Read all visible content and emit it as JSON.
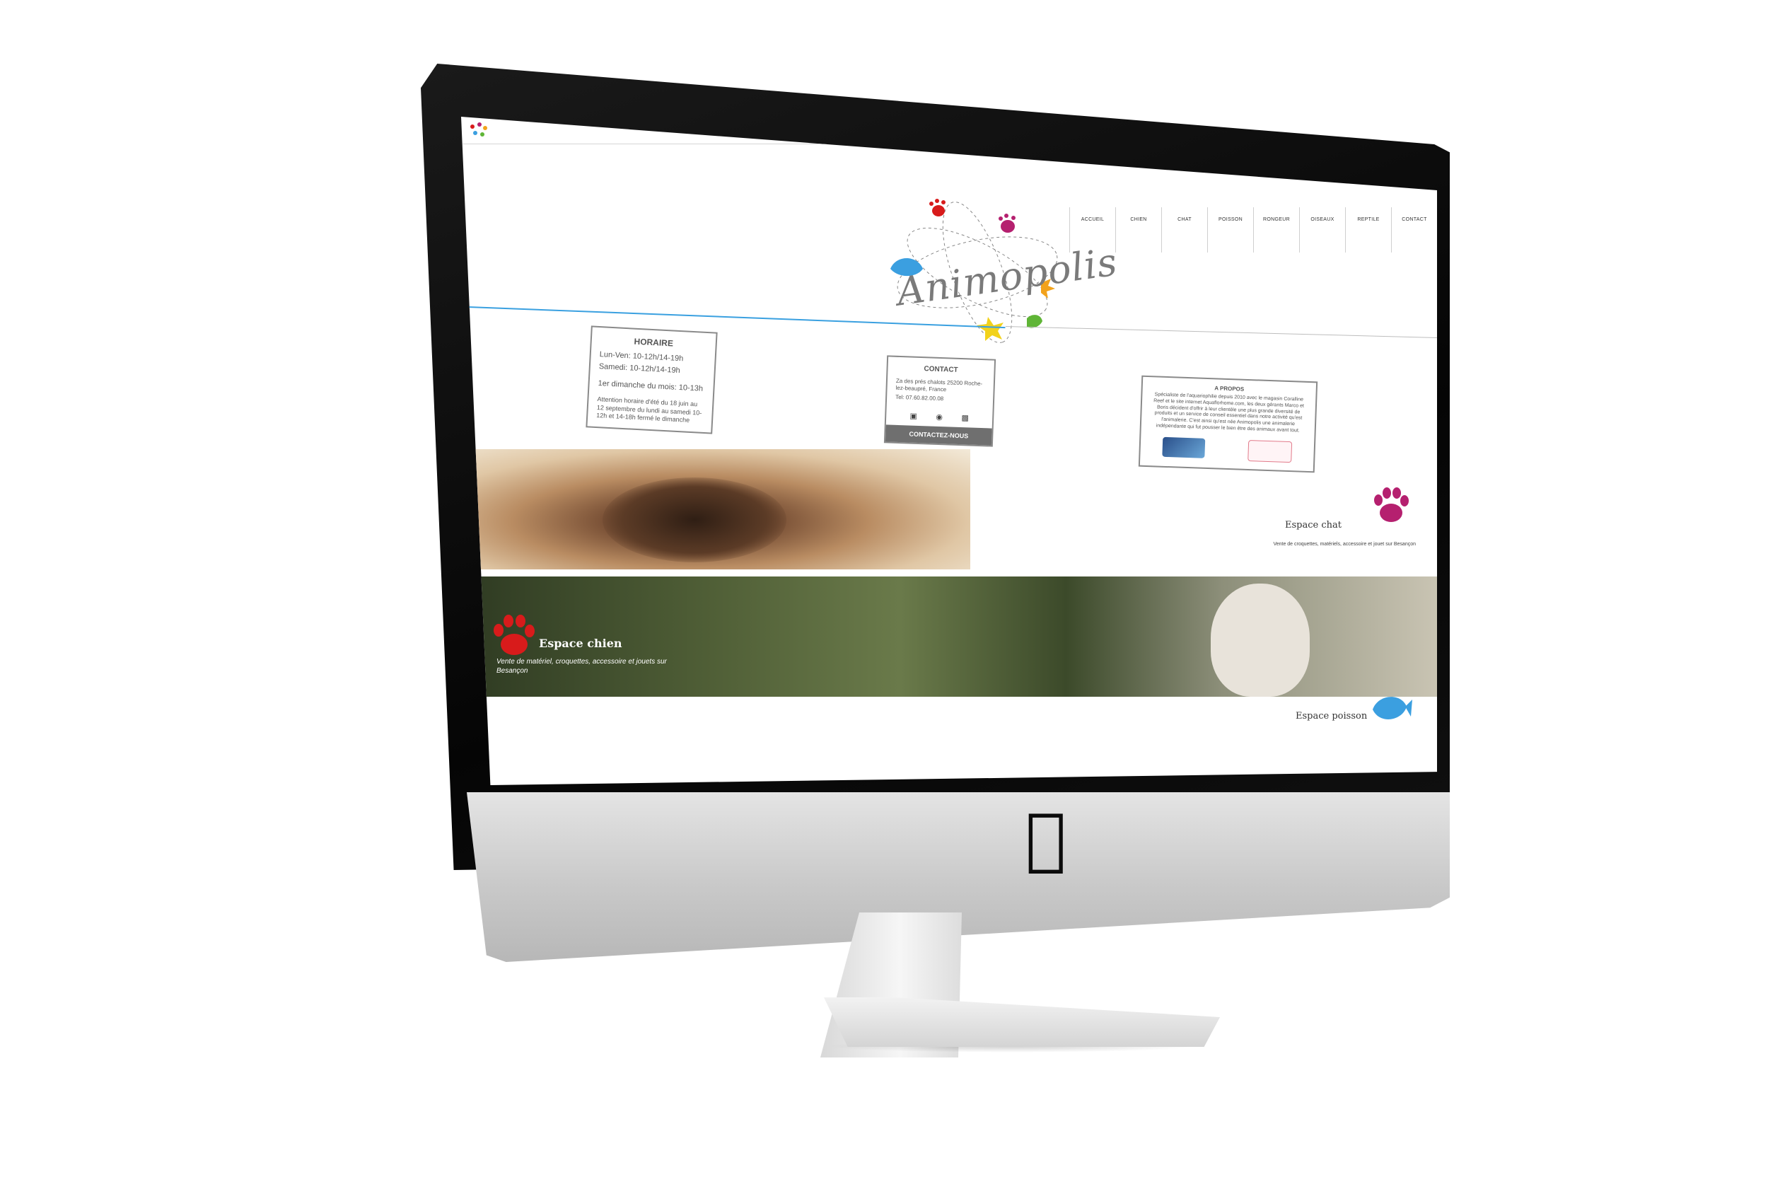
{
  "site": {
    "name": "Animopolis",
    "nav": [
      "ACCUEIL",
      "CHIEN",
      "CHAT",
      "POISSON",
      "RONGEUR",
      "OISEAUX",
      "REPTILE",
      "CONTACT"
    ],
    "horaire": {
      "title": "HORAIRE",
      "lines": [
        "Lun-Ven: 10-12h/14-19h",
        "Samedi: 10-12h/14-19h",
        "1er dimanche du mois: 10-13h",
        "Attention horaire d'été du 18 juin au 12 septembre du lundi au samedi 10-12h et 14-18h fermé le dimanche"
      ]
    },
    "contact": {
      "title": "CONTACT",
      "address": "Za des prés chalots 25200 Roche-lez-beaupré, France",
      "phone": "Tel: 07.60.82.00.08",
      "button": "CONTACTEZ-NOUS"
    },
    "apropos": {
      "title": "A PROPOS",
      "text": "Spécialiste de l'aquariophilie depuis 2010 avec le magasin Coralline Reef et le site internet Aquaflorhome.com, les deux gérants Marco et Boris décident d'offrir à leur clientèle une plus grande diversité de produits et un service de conseil essentiel dans notre activité qu'est l'animalerie. C'est ainsi qu'est née Animopolis une animalerie indépendante qui fut pousser le bien être des animaux avant tout."
    },
    "espace_chat": {
      "title": "Espace chat",
      "subtitle": "Vente de croquettes, matériels, accessoire et jouet sur Besançon"
    },
    "espace_chien": {
      "title": "Espace chien",
      "subtitle": "Vente de matériel, croquettes, accessoire et jouets sur Besançon"
    },
    "espace_poisson": {
      "title": "Espace poisson"
    }
  },
  "colors": {
    "accent_blue": "#3aa0e0",
    "paw_magenta": "#b5206f",
    "paw_red": "#d81b1b",
    "fish_blue": "#3b9fe0",
    "button_grey": "#6f6f6f"
  },
  "icons": [
    "apple-logo-icon",
    "facebook-icon",
    "instagram-icon",
    "twitter-icon",
    "cat-paw-icon",
    "dog-paw-icon",
    "fish-icon"
  ]
}
